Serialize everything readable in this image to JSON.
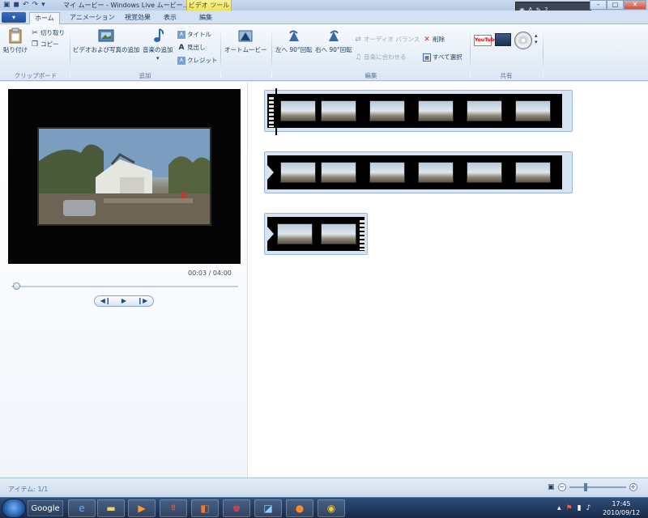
{
  "window": {
    "title": "マイ ムービー - Windows Live ムービー…",
    "context_tools": "ビデオ ツール",
    "qat_icons": [
      "save-icon",
      "undo-icon",
      "redo-icon",
      "qat-dropdown-icon"
    ],
    "window_buttons": [
      "minimize",
      "maximize",
      "close"
    ]
  },
  "tabs": {
    "file": "▾",
    "items": [
      "ホーム",
      "アニメーション",
      "視覚効果",
      "表示",
      "編集"
    ],
    "active": "ホーム"
  },
  "ribbon": {
    "clipboard": {
      "paste": "貼り付け",
      "cut": "切り取り",
      "copy": "コピー",
      "label": "クリップボード"
    },
    "add": {
      "add_video_photo": "ビデオおよび写真の追加",
      "add_music": "音楽の追加",
      "title": "タイトル",
      "caption": "見出し",
      "credits": "クレジット",
      "label": "追加"
    },
    "automovie": "オートムービー",
    "edit": {
      "rotate_left": "左へ 90°回転",
      "rotate_right": "右へ 90°回転",
      "audio_balance": "オーディオ バランス",
      "fit_to_music": "音楽に合わせる",
      "delete": "削除",
      "select_all": "すべて選択",
      "label": "編集"
    },
    "share": {
      "label": "共有",
      "dvd_text": "DVD",
      "youtube_text": "YouTube"
    }
  },
  "preview": {
    "timecode": "00:03 / 04:00",
    "position_fraction": 0.0125
  },
  "storyboard": {
    "clips": [
      {
        "frames": 6,
        "start_marker": "sprocket",
        "end_marker": "arrow",
        "selected": true
      },
      {
        "frames": 6,
        "start_marker": "arrow",
        "end_marker": "arrow",
        "selected": false
      },
      {
        "frames": 2,
        "start_marker": "arrow",
        "end_marker": "sprocket",
        "selected": false
      }
    ]
  },
  "statusbar": {
    "items": "アイテム: 1/1"
  },
  "taskbar": {
    "search_label": "Google",
    "apps": [
      "ie-icon",
      "explorer-icon",
      "media-player-icon",
      "pep-icon",
      "app-icon",
      "game-icon",
      "app-icon-2",
      "firefox-icon",
      "chrome-icon"
    ],
    "time": "17:45",
    "date": "2010/09/12"
  },
  "colors": {
    "accent": "#1e395b",
    "ribbon_bg": "#dbe7f4",
    "context_tab": "#ede25a",
    "clip_border": "#9bb6d8"
  }
}
